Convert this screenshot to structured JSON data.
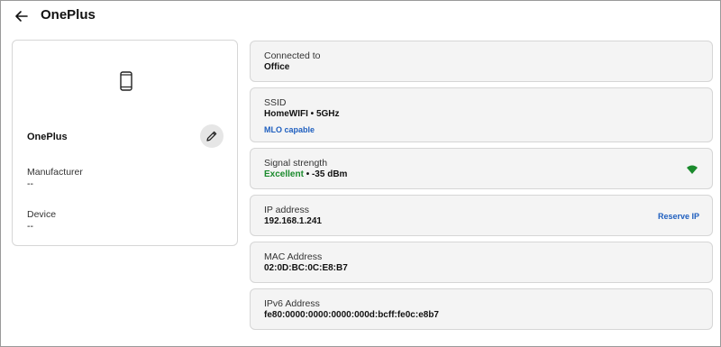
{
  "header": {
    "title": "OnePlus"
  },
  "device": {
    "name": "OnePlus",
    "manufacturer_label": "Manufacturer",
    "manufacturer_value": "--",
    "device_label": "Device",
    "device_value": "--"
  },
  "details": {
    "connected_to": {
      "label": "Connected to",
      "value": "Office"
    },
    "ssid": {
      "label": "SSID",
      "value": "HomeWIFI • 5GHz",
      "link": "MLO capable"
    },
    "signal": {
      "label": "Signal strength",
      "quality": "Excellent",
      "dbm": " • -35 dBm"
    },
    "ip": {
      "label": "IP address",
      "value": "192.168.1.241",
      "action": "Reserve IP"
    },
    "mac": {
      "label": "MAC Address",
      "value": "02:0D:BC:0C:E8:B7"
    },
    "ipv6": {
      "label": "IPv6 Address",
      "value": "fe80:0000:0000:0000:000d:bcff:fe0c:e8b7"
    }
  },
  "colors": {
    "link": "#1f5fbf",
    "signal_good": "#1a8a2c",
    "card_bg": "#f4f4f4",
    "border": "#d6d6d6"
  },
  "icons": [
    "back-arrow-icon",
    "smartphone-icon",
    "pencil-icon",
    "wifi-signal-icon"
  ]
}
